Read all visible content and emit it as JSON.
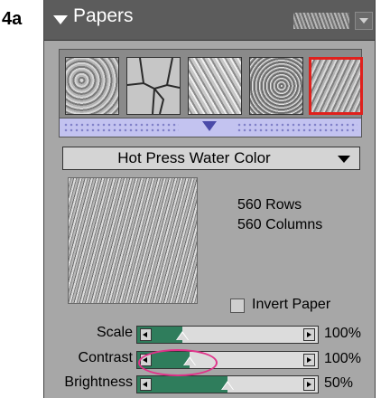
{
  "figure_label": "4a",
  "palette": {
    "title": "Papers",
    "paper_swatches": [
      {
        "name": "swatch-1",
        "selected": false
      },
      {
        "name": "swatch-2",
        "selected": false
      },
      {
        "name": "swatch-3",
        "selected": false
      },
      {
        "name": "swatch-4",
        "selected": false
      },
      {
        "name": "swatch-5",
        "selected": true
      }
    ],
    "dropdown_value": "Hot Press Water Color",
    "info": {
      "rows": "560 Rows",
      "columns": "560 Columns"
    },
    "invert_paper": {
      "label": "Invert Paper",
      "checked": false
    },
    "sliders": [
      {
        "label": "Scale",
        "value_text": "100%",
        "fraction": 0.2
      },
      {
        "label": "Contrast",
        "value_text": "100%",
        "fraction": 0.25
      },
      {
        "label": "Brightness",
        "value_text": "50%",
        "fraction": 0.5
      }
    ]
  },
  "colors": {
    "selected_swatch_border": "#e0201c",
    "slider_fill": "#2f7d5c",
    "highlight": "#e0338a"
  }
}
